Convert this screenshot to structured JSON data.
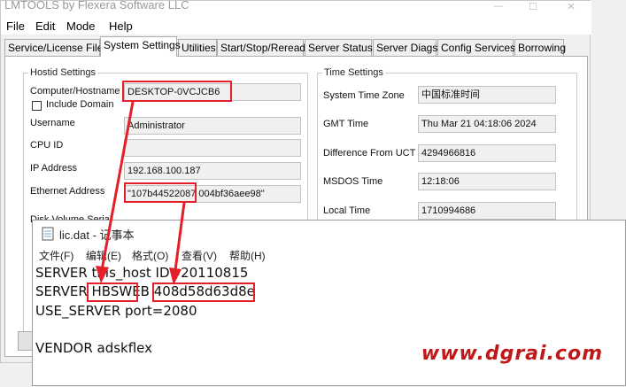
{
  "window": {
    "title": "LMTOOLS by Flexera Software LLC",
    "controls": [
      "—",
      "☐",
      "✕"
    ]
  },
  "menu": [
    "File",
    "Edit",
    "Mode",
    "Help"
  ],
  "tabs": [
    "Service/License File",
    "System Settings",
    "Utilities",
    "Start/Stop/Reread",
    "Server Status",
    "Server Diags",
    "Config Services",
    "Borrowing"
  ],
  "hostid": {
    "group_label": "Hostid Settings",
    "computer_label": "Computer/Hostname",
    "computer_value": "DESKTOP-0VCJCB6",
    "include_domain_label": "Include Domain",
    "username_label": "Username",
    "username_value": "Administrator",
    "cpuid_label": "CPU ID",
    "cpuid_value": "",
    "ip_label": "IP Address",
    "ip_value": "192.168.100.187",
    "ethernet_label": "Ethernet Address",
    "ethernet_value": "\"107b44522087 004bf36aee98\"",
    "partial_label": "Disk Volume Serial"
  },
  "time": {
    "group_label": "Time Settings",
    "tz_label": "System Time Zone",
    "tz_value": "中国标准时间",
    "gmt_label": "GMT Time",
    "gmt_value": "Thu Mar 21 04:18:06 2024",
    "diff_label": "Difference From UCT",
    "diff_value": "4294966816",
    "msdos_label": "MSDOS Time",
    "msdos_value": "12:18:06",
    "local_label": "Local Time",
    "local_value": "1710994686"
  },
  "notepad": {
    "title": "lic.dat - 记事本",
    "menu": [
      "文件(F)",
      "编辑(E)",
      "格式(O)",
      "查看(V)",
      "帮助(H)"
    ],
    "lines": {
      "l1": "SERVER this_host ID=20110815",
      "l2a": "SERVER ",
      "l2b": "HBSWEB",
      "l2c": " ",
      "l2d": "408d58d63d8e",
      "l3": "USE_SERVER port=2080",
      "l4": "VENDOR adskflex"
    }
  },
  "watermark": "www.dgrai.com",
  "colors": {
    "highlight": "#e3202a",
    "watermark": "#c01818"
  }
}
